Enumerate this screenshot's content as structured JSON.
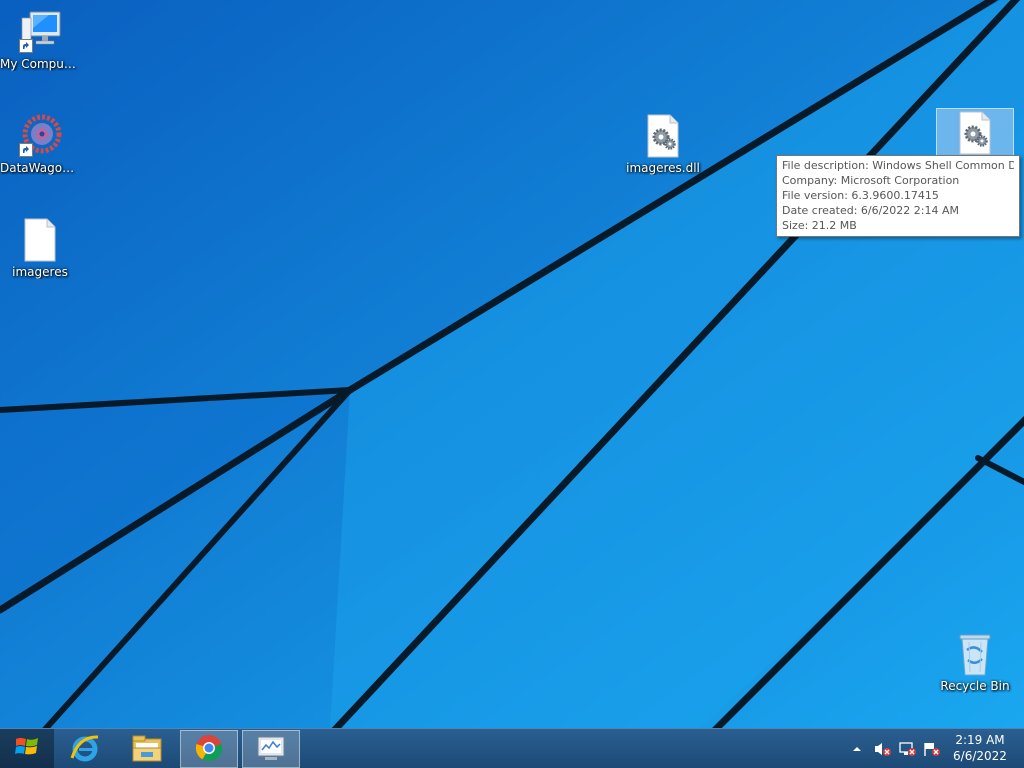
{
  "desktop": {
    "icons": [
      {
        "label": "My Computer",
        "icon": "computer-icon",
        "shortcut": true
      },
      {
        "label": "DataWagon...",
        "icon": "gear-app-icon",
        "shortcut": true
      },
      {
        "label": "imageres",
        "icon": "blank-file-icon",
        "shortcut": false
      },
      {
        "label": "imageres.dll",
        "icon": "dll-file-icon",
        "shortcut": false
      },
      {
        "label": "",
        "icon": "dll-file-icon",
        "shortcut": false,
        "selected": true
      },
      {
        "label": "Recycle Bin",
        "icon": "recycle-bin-icon",
        "shortcut": false
      }
    ]
  },
  "tooltip": {
    "lines": [
      "File description: Windows Shell Common Dll",
      "Company: Microsoft Corporation",
      "File version: 6.3.9600.17415",
      "Date created: 6/6/2022 2:14 AM",
      "Size: 21.2 MB"
    ]
  },
  "taskbar": {
    "start": "windows-logo-icon",
    "buttons": [
      {
        "app": "Internet Explorer",
        "icon": "internet-explorer-icon",
        "active": false
      },
      {
        "app": "File Explorer",
        "icon": "file-explorer-icon",
        "active": false
      },
      {
        "app": "Google Chrome",
        "icon": "chrome-icon",
        "active": true
      },
      {
        "app": "Resource Monitor",
        "icon": "monitor-app-icon",
        "active": true
      }
    ],
    "tray": {
      "icons": [
        "show-hidden-icons-chevron",
        "volume-muted-icon",
        "network-disconnected-icon",
        "action-center-flag-icon"
      ],
      "time": "2:19 AM",
      "date": "6/6/2022"
    }
  },
  "colors": {
    "wallpaper": "#0d84dc",
    "taskbar": "#245684",
    "tooltip_text": "#575757"
  }
}
